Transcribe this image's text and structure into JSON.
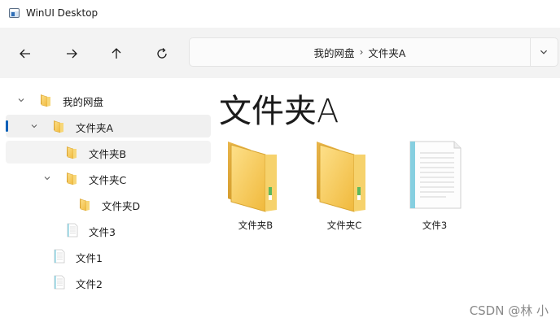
{
  "window": {
    "title": "WinUI Desktop"
  },
  "toolbar": {
    "back_icon": "arrow-left-icon",
    "forward_icon": "arrow-right-icon",
    "up_icon": "arrow-up-icon",
    "refresh_icon": "refresh-icon",
    "breadcrumb": [
      {
        "label": "我的网盘"
      },
      {
        "label": "文件夹A"
      }
    ],
    "separator": "›"
  },
  "tree": {
    "items": [
      {
        "label": "我的网盘",
        "icon": "folder-icon",
        "expanded": true
      },
      {
        "label": "文件夹A",
        "icon": "folder-icon",
        "expanded": true,
        "selected": true
      },
      {
        "label": "文件夹B",
        "icon": "folder-icon"
      },
      {
        "label": "文件夹C",
        "icon": "folder-icon",
        "expanded": true
      },
      {
        "label": "文件夹D",
        "icon": "folder-icon"
      },
      {
        "label": "文件3",
        "icon": "document-icon"
      },
      {
        "label": "文件1",
        "icon": "document-icon"
      },
      {
        "label": "文件2",
        "icon": "document-icon"
      }
    ]
  },
  "content": {
    "title": "文件夹A",
    "items": [
      {
        "label": "文件夹B",
        "icon": "folder-icon"
      },
      {
        "label": "文件夹C",
        "icon": "folder-icon"
      },
      {
        "label": "文件3",
        "icon": "document-icon"
      }
    ]
  },
  "watermark": "CSDN @林 小",
  "colors": {
    "accent": "#005fb8",
    "folder": "#f5c74f",
    "toolbar_bg": "#f3f3f3"
  }
}
